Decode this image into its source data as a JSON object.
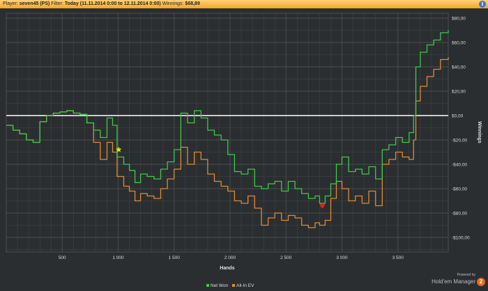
{
  "header": {
    "player_label": "Player:",
    "player_value": "seven45 (PS)",
    "filter_label": "Filter:",
    "filter_value": "Today (11.11.2014 0:00 to 12.11.2014 0:00)",
    "winnings_label": "Winnings:",
    "winnings_value": "$68,89",
    "info_glyph": "i"
  },
  "branding": {
    "powered_by": "Powered by",
    "product": "Hold'em Manager",
    "logo_text": "2"
  },
  "colors": {
    "net_won": "#3ec94a",
    "allin_ev": "#e08a34",
    "zero_line": "#ffffff",
    "grid": "#4a4e51",
    "plot_bg": "#2b2e30",
    "header": "#f5a623"
  },
  "chart_data": {
    "type": "line",
    "xlabel": "Hands",
    "ylabel": "Winnings",
    "xlim": [
      0,
      3950
    ],
    "ylim": [
      -112,
      84
    ],
    "x_ticks": [
      500,
      1000,
      1500,
      2000,
      2500,
      3000,
      3500
    ],
    "x_tick_labels": [
      "500",
      "1 000",
      "1 500",
      "2 000",
      "2 500",
      "3 000",
      "3 500"
    ],
    "y_ticks": [
      80,
      60,
      40,
      20,
      0,
      -20,
      -40,
      -60,
      -80,
      -100
    ],
    "y_tick_labels": [
      "$80,00",
      "$60,00",
      "$40,00",
      "$20,00",
      "$0,00",
      "-$20,00",
      "-$40,00",
      "-$60,00",
      "-$80,00",
      "-$100,00"
    ],
    "grid": true,
    "legend_position": "bottom-center",
    "series": [
      {
        "name": "Net Won",
        "color": "#3ec94a",
        "x": [
          0,
          60,
          120,
          180,
          240,
          300,
          360,
          420,
          480,
          540,
          600,
          660,
          720,
          780,
          840,
          900,
          950,
          990,
          1050,
          1100,
          1150,
          1200,
          1260,
          1320,
          1380,
          1440,
          1500,
          1560,
          1620,
          1680,
          1740,
          1800,
          1860,
          1920,
          1980,
          2040,
          2100,
          2160,
          2220,
          2280,
          2340,
          2400,
          2460,
          2520,
          2580,
          2640,
          2700,
          2760,
          2800,
          2850,
          2900,
          2950,
          3000,
          3060,
          3120,
          3180,
          3240,
          3300,
          3360,
          3420,
          3480,
          3540,
          3600,
          3640,
          3660,
          3700,
          3760,
          3820,
          3880,
          3950
        ],
        "values": [
          -8,
          -12,
          -15,
          -20,
          -22,
          -5,
          0,
          2,
          3,
          4,
          2,
          1,
          -6,
          -12,
          -18,
          -2,
          -8,
          -34,
          -40,
          -45,
          -55,
          -48,
          -50,
          -52,
          -44,
          -38,
          -28,
          2,
          -6,
          4,
          -2,
          -12,
          -16,
          -20,
          -32,
          -46,
          -48,
          -44,
          -58,
          -60,
          -56,
          -54,
          -62,
          -54,
          -60,
          -64,
          -68,
          -66,
          -72,
          -66,
          -56,
          -40,
          -34,
          -46,
          -44,
          -48,
          -42,
          -52,
          -28,
          -24,
          -18,
          -22,
          -14,
          0,
          40,
          52,
          58,
          62,
          68,
          70
        ]
      },
      {
        "name": "All-In EV",
        "color": "#e08a34",
        "x": [
          0,
          60,
          120,
          180,
          240,
          300,
          360,
          420,
          480,
          540,
          600,
          660,
          720,
          780,
          840,
          900,
          950,
          990,
          1050,
          1100,
          1150,
          1200,
          1260,
          1320,
          1380,
          1440,
          1500,
          1560,
          1620,
          1680,
          1740,
          1800,
          1860,
          1920,
          1980,
          2040,
          2100,
          2160,
          2220,
          2280,
          2340,
          2400,
          2460,
          2520,
          2580,
          2640,
          2700,
          2760,
          2800,
          2850,
          2900,
          2950,
          3000,
          3060,
          3120,
          3180,
          3240,
          3300,
          3360,
          3420,
          3480,
          3540,
          3600,
          3640,
          3660,
          3700,
          3760,
          3820,
          3880,
          3950
        ],
        "values": [
          -8,
          -12,
          -15,
          -20,
          -22,
          -5,
          0,
          2,
          3,
          4,
          2,
          1,
          -6,
          -22,
          -36,
          -22,
          -30,
          -50,
          -58,
          -62,
          -70,
          -64,
          -66,
          -68,
          -60,
          -52,
          -44,
          -26,
          -40,
          -30,
          -36,
          -48,
          -54,
          -58,
          -62,
          -70,
          -72,
          -66,
          -76,
          -90,
          -84,
          -80,
          -86,
          -82,
          -84,
          -90,
          -92,
          -88,
          -90,
          -86,
          -68,
          -54,
          -60,
          -70,
          -66,
          -72,
          -62,
          -74,
          -40,
          -36,
          -30,
          -34,
          -36,
          -20,
          12,
          24,
          32,
          38,
          46,
          48
        ]
      }
    ],
    "markers": [
      {
        "shape": "star",
        "color": "#ffe100",
        "x": 1005,
        "y": -28
      },
      {
        "shape": "heart",
        "color": "#e02020",
        "x": 2825,
        "y": -74
      }
    ]
  }
}
